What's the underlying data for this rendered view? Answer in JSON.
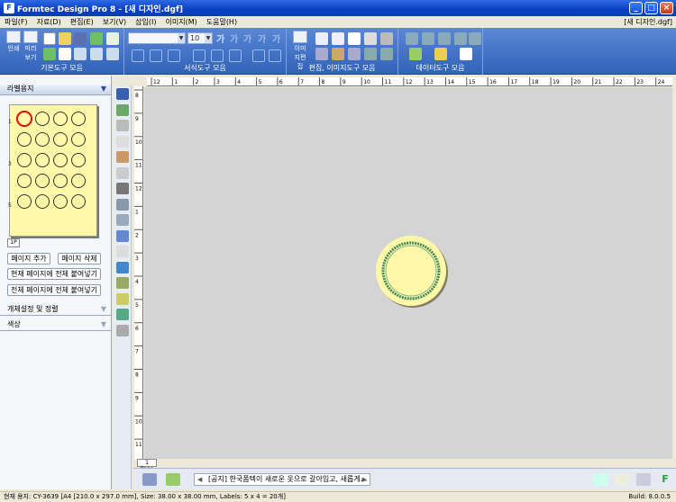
{
  "window": {
    "title": "Formtec Design Pro 8 - [새 디자인.dgf]",
    "doc_title": "[새 디자인.dgf]"
  },
  "menu": [
    "파일(F)",
    "자료(D)",
    "편집(E)",
    "보기(V)",
    "삽입(I)",
    "이미지(M)",
    "도움말(H)"
  ],
  "ribbon": {
    "basic_group": "기본도구 모음",
    "format_group": "서식도구 모음",
    "edit_group": "편집, 이미지도구 모음",
    "data_group": "데이터도구 모음",
    "print_label": "인쇄",
    "preview_label": "미리보기",
    "image_edit_label": "이미지편집",
    "font_combo": "",
    "size_combo": "10",
    "ga": "가"
  },
  "left_panel": {
    "header": "라벨용지",
    "rows": [
      "1",
      "3",
      "5"
    ],
    "page_tab": "1P",
    "add_page": "페이지 추가",
    "delete_page": "페이지 삭제",
    "paste_current": "현재 페이지에 전체 붙여넣기",
    "paste_all": "전체 페이지에 전체 붙여넣기",
    "obj_section": "개체설정 및 정렬",
    "color_section": "색상"
  },
  "ruler": {
    "x_ticks": [
      "12",
      "1",
      "2",
      "3",
      "4",
      "5",
      "6",
      "7",
      "8",
      "9",
      "10",
      "11",
      "12",
      "13",
      "14",
      "15",
      "16",
      "17",
      "18",
      "19",
      "20",
      "21",
      "22",
      "23",
      "24"
    ],
    "y_ticks": [
      "8",
      "9",
      "10",
      "11",
      "12",
      "1",
      "2",
      "3",
      "4",
      "5",
      "6",
      "7",
      "8",
      "9",
      "10",
      "11"
    ]
  },
  "canvas": {
    "page_tab": "1 Page"
  },
  "notice": "[공지] 한국폼텍이 새로운 옷으로 갈아입고, 새롭게...",
  "status": {
    "left": "현재 용지: CY-3639 [A4 [210.0 x 297.0 mm], Size: 38.00 x 38.00 mm, Labels: 5 x 4 = 20개]",
    "build": "Build: 8.0.0.5"
  },
  "colors": {
    "ribbon": "#3163b8",
    "label": "#fff8a8",
    "canvas": "#d4d4d4",
    "titlebar": "#0a3fc2"
  }
}
